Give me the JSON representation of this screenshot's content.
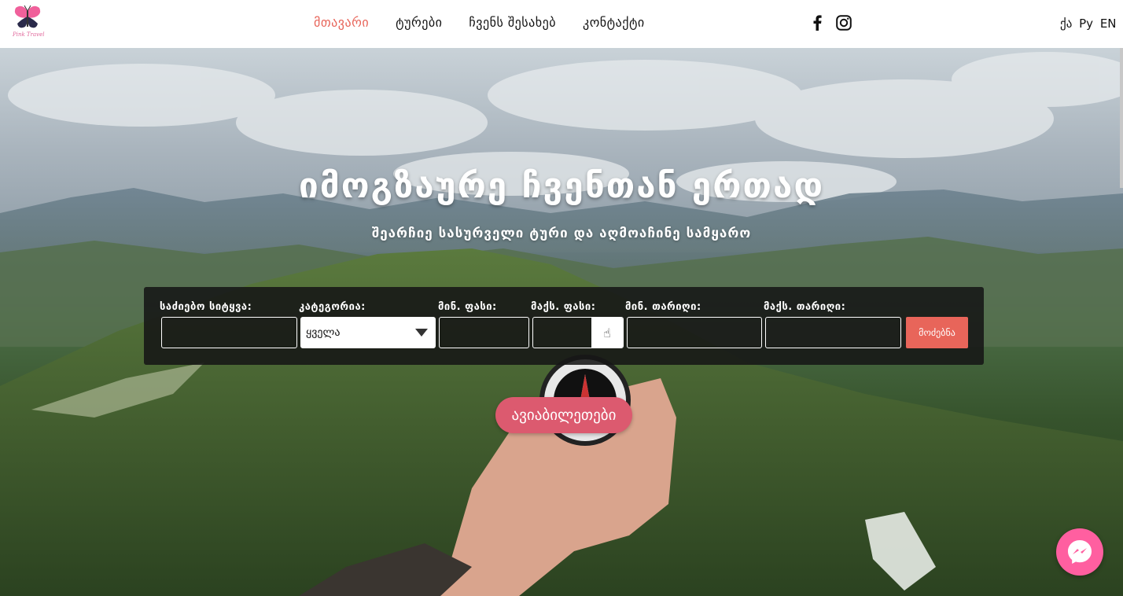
{
  "header": {
    "logo_text": "Pink Travel",
    "nav": [
      {
        "label": "მთავარი",
        "active": true
      },
      {
        "label": "ტურები",
        "active": false
      },
      {
        "label": "ჩვენს შესახებ",
        "active": false
      },
      {
        "label": "კონტაქტი",
        "active": false
      }
    ],
    "social": [
      "facebook-icon",
      "instagram-icon"
    ],
    "languages": [
      "ქა",
      "Ру",
      "EN"
    ]
  },
  "hero": {
    "title": "იმოგზაურე ჩვენთან ერთად",
    "subtitle": "შეარჩიე სასურველი ტური და აღმოაჩინე სამყარო",
    "tickets_button": "ავიაბილეთები"
  },
  "search": {
    "keyword_label": "საძიებო სიტყვა:",
    "keyword_value": "",
    "category_label": "კატეგორია:",
    "category_value": "ყველა",
    "min_price_label": "მინ. ფასი:",
    "min_price_value": "",
    "max_price_label": "მაქს. ფასი:",
    "max_price_value": "",
    "min_date_label": "მინ. თარიღი:",
    "min_date_value": "",
    "max_date_label": "მაქს. თარიღი:",
    "max_date_value": "",
    "submit_label": "მოძებნა"
  },
  "colors": {
    "accent": "#e8655a",
    "tickets": "#dc5a6f",
    "messenger": "#ff5fa0"
  }
}
